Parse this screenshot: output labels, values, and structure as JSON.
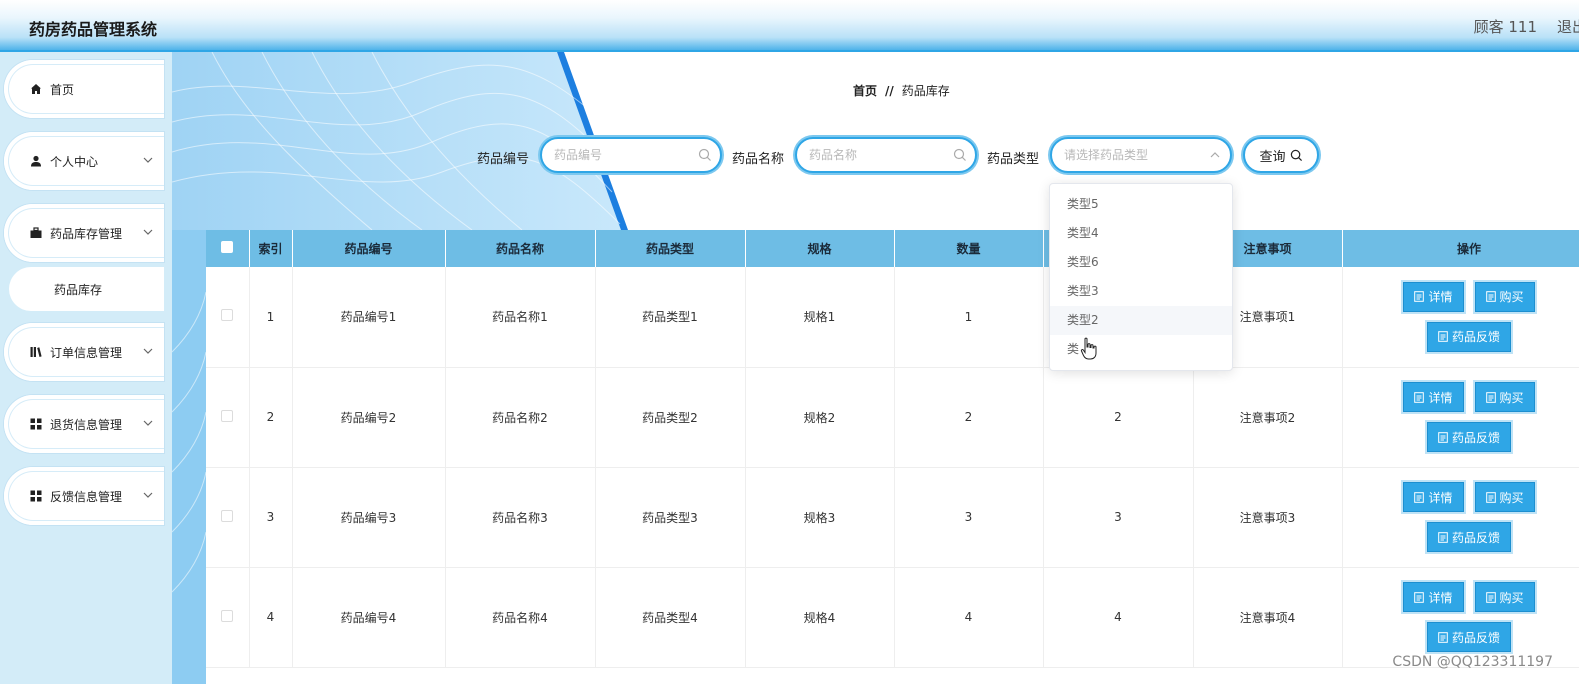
{
  "header": {
    "title": "药房药品管理系统",
    "user": "顾客 111",
    "logout": "退出"
  },
  "sidebar": {
    "items": [
      {
        "label": "首页",
        "icon": "home-icon"
      },
      {
        "label": "个人中心",
        "icon": "user-icon"
      },
      {
        "label": "药品库存管理",
        "icon": "briefcase-icon"
      },
      {
        "label": "订单信息管理",
        "icon": "library-icon"
      },
      {
        "label": "退货信息管理",
        "icon": "grid-icon"
      },
      {
        "label": "反馈信息管理",
        "icon": "grid-icon"
      }
    ],
    "active_sub": "药品库存"
  },
  "breadcrumb": {
    "home": "首页",
    "sep": "//",
    "current": "药品库存"
  },
  "search": {
    "code_label": "药品编号",
    "code_placeholder": "药品编号",
    "name_label": "药品名称",
    "name_placeholder": "药品名称",
    "type_label": "药品类型",
    "type_placeholder": "请选择药品类型",
    "query_label": "查询"
  },
  "dropdown": {
    "options": [
      "类型5",
      "类型4",
      "类型6",
      "类型3",
      "类型2",
      "类型1"
    ],
    "hovered": "类型2",
    "partial_visible": "类"
  },
  "table": {
    "headers": [
      "索引",
      "药品编号",
      "药品名称",
      "药品类型",
      "规格",
      "数量",
      "",
      "注意事项",
      "操作"
    ],
    "rows": [
      {
        "idx": "1",
        "code": "药品编号1",
        "name": "药品名称1",
        "type": "药品类型1",
        "spec": "规格1",
        "qty": "1",
        "col7": "",
        "note": "注意事项1"
      },
      {
        "idx": "2",
        "code": "药品编号2",
        "name": "药品名称2",
        "type": "药品类型2",
        "spec": "规格2",
        "qty": "2",
        "col7": "2",
        "note": "注意事项2"
      },
      {
        "idx": "3",
        "code": "药品编号3",
        "name": "药品名称3",
        "type": "药品类型3",
        "spec": "规格3",
        "qty": "3",
        "col7": "3",
        "note": "注意事项3"
      },
      {
        "idx": "4",
        "code": "药品编号4",
        "name": "药品名称4",
        "type": "药品类型4",
        "spec": "规格4",
        "qty": "4",
        "col7": "4",
        "note": "注意事项4"
      }
    ],
    "actions": {
      "detail": "详情",
      "buy": "购买",
      "feedback": "药品反馈"
    }
  },
  "watermark": "CSDN @QQ123311197",
  "colors": {
    "accent": "#2fa6e6",
    "header_row": "#6ebde5",
    "sidebar_bg": "#d3ecf8"
  }
}
